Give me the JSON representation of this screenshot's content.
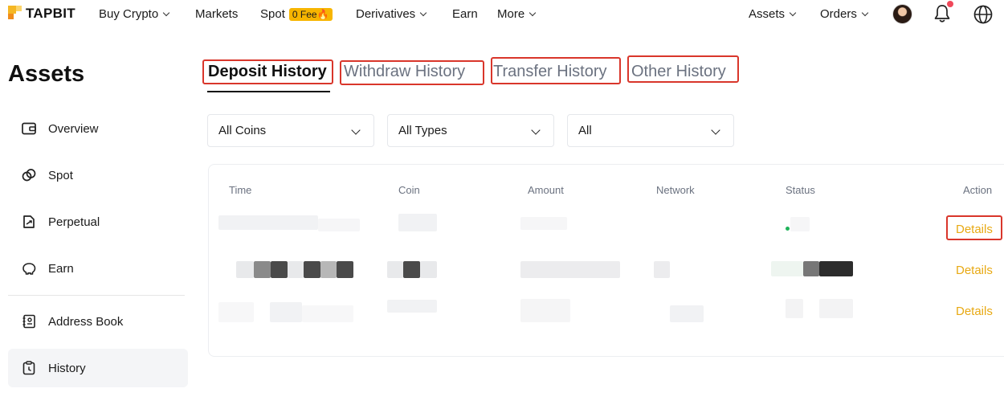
{
  "brand": {
    "name": "TAPBIT"
  },
  "nav": {
    "buy_crypto": "Buy Crypto",
    "markets": "Markets",
    "spot": "Spot",
    "spot_badge": "0 Fee🔥",
    "derivatives": "Derivatives",
    "earn": "Earn",
    "more": "More",
    "assets": "Assets",
    "orders": "Orders"
  },
  "sidebar": {
    "title": "Assets",
    "items": [
      {
        "label": "Overview",
        "icon": "wallet-icon"
      },
      {
        "label": "Spot",
        "icon": "coins-icon"
      },
      {
        "label": "Perpetual",
        "icon": "contract-icon"
      },
      {
        "label": "Earn",
        "icon": "piggy-bank-icon"
      },
      {
        "label": "Address Book",
        "icon": "address-book-icon"
      },
      {
        "label": "History",
        "icon": "history-icon",
        "active": true
      }
    ]
  },
  "tabs": [
    {
      "label": "Deposit History",
      "active": true
    },
    {
      "label": "Withdraw History"
    },
    {
      "label": "Transfer History"
    },
    {
      "label": "Other History"
    }
  ],
  "filters": [
    {
      "value": "All Coins"
    },
    {
      "value": "All Types"
    },
    {
      "value": "All"
    }
  ],
  "table": {
    "columns": [
      "Time",
      "Coin",
      "Amount",
      "Network",
      "Status",
      "Action"
    ],
    "rows": [
      {
        "action": "Details"
      },
      {
        "action": "Details"
      },
      {
        "action": "Details"
      }
    ]
  },
  "colors": {
    "accent": "#e8a913",
    "highlight_box": "#d9362b",
    "brand_yellow": "#f5b724",
    "status_green": "#1fb35a"
  }
}
